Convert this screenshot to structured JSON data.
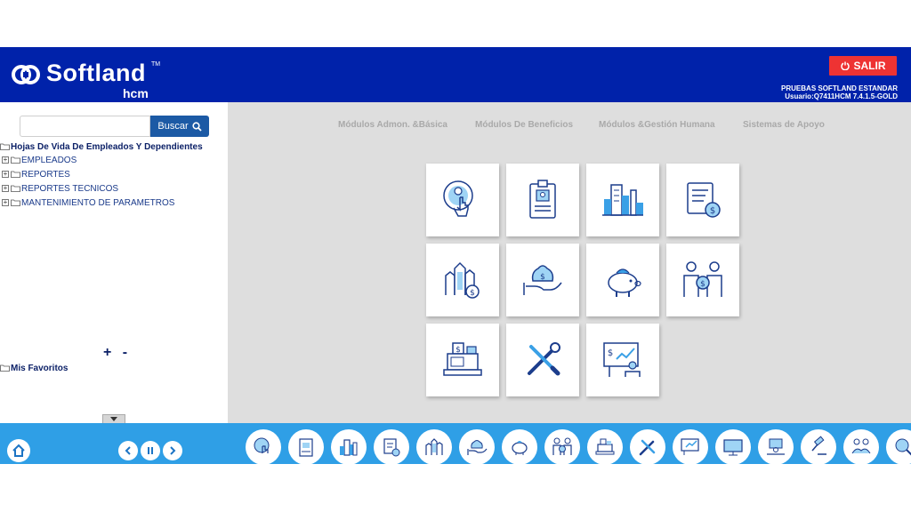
{
  "header": {
    "brand": "Softland",
    "brand_tm": "TM",
    "brand_sub": "hcm",
    "logout_label": "SALIR",
    "env_name": "PRUEBAS SOFTLAND ESTANDAR",
    "user_info": "Usuario:Q7411HCM 7.4.1.5-GOLD",
    "color_header": "#0022aa",
    "color_logout": "#ee3333"
  },
  "search": {
    "placeholder": "",
    "value": "",
    "button_label": "Buscar"
  },
  "tree": {
    "root_label": "Hojas De Vida De Empleados Y Dependientes",
    "items": [
      {
        "label": "EMPLEADOS",
        "expander": "+"
      },
      {
        "label": "REPORTES",
        "expander": "+"
      },
      {
        "label": "REPORTES TECNICOS",
        "expander": "+"
      },
      {
        "label": "MANTENIMIENTO DE PARAMETROS",
        "expander": "+"
      }
    ],
    "expand_collapse": "+ -",
    "favorites_label": "Mis Favoritos"
  },
  "nav_tabs": [
    {
      "label": "Módulos Admon. &Básica"
    },
    {
      "label": "Módulos De Beneficios"
    },
    {
      "label": "Módulos &Gestión Humana"
    },
    {
      "label": "Sistemas de Apoyo"
    }
  ],
  "module_tiles": [
    {
      "icon": "touch-hand-icon"
    },
    {
      "icon": "id-badge-icon"
    },
    {
      "icon": "city-buildings-icon"
    },
    {
      "icon": "invoice-dollar-icon"
    },
    {
      "icon": "buildings-dollar-icon"
    },
    {
      "icon": "hand-money-bag-icon"
    },
    {
      "icon": "piggy-bank-icon"
    },
    {
      "icon": "people-dollar-icon"
    },
    {
      "icon": "cash-register-icon"
    },
    {
      "icon": "wrench-screwdriver-icon"
    },
    {
      "icon": "presentation-chart-icon"
    }
  ],
  "footer": {
    "color_bar": "#2f9fe6",
    "modules": [
      {
        "icon": "touch-hand-icon"
      },
      {
        "icon": "id-badge-icon"
      },
      {
        "icon": "city-buildings-icon"
      },
      {
        "icon": "invoice-dollar-icon"
      },
      {
        "icon": "buildings-dollar-icon"
      },
      {
        "icon": "hand-money-bag-icon"
      },
      {
        "icon": "piggy-bank-icon"
      },
      {
        "icon": "people-dollar-icon"
      },
      {
        "icon": "cash-register-icon"
      },
      {
        "icon": "wrench-screwdriver-icon"
      },
      {
        "icon": "presentation-chart-icon"
      },
      {
        "icon": "computer-monitor-icon"
      },
      {
        "icon": "desk-worker-icon"
      },
      {
        "icon": "gavel-icon"
      },
      {
        "icon": "handshake-people-icon"
      },
      {
        "icon": "search-person-icon"
      }
    ]
  }
}
